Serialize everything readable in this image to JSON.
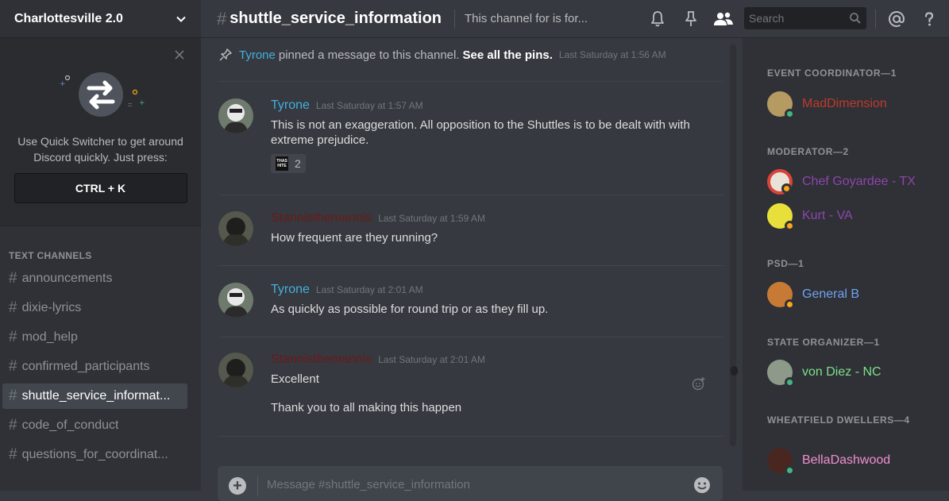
{
  "server": {
    "name": "Charlottesville 2.0"
  },
  "quick_switcher": {
    "text": "Use Quick Switcher to get around Discord quickly. Just press:",
    "shortcut": "CTRL + K"
  },
  "channels": {
    "category": "TEXT CHANNELS",
    "items": [
      {
        "label": "announcements"
      },
      {
        "label": "dixie-lyrics"
      },
      {
        "label": "mod_help"
      },
      {
        "label": "confirmed_participants"
      },
      {
        "label": "shuttle_service_informat..."
      },
      {
        "label": "code_of_conduct"
      },
      {
        "label": "questions_for_coordinat..."
      }
    ]
  },
  "header": {
    "channel": "shuttle_service_information",
    "topic": "This channel for is for...",
    "search_placeholder": "Search",
    "hash": "#"
  },
  "system_message": {
    "user": "Tyrone",
    "text": "pinned a message to this channel.",
    "link": "See all the pins.",
    "timestamp": "Last Saturday at 1:56 AM"
  },
  "messages": [
    {
      "author": "Tyrone",
      "color": "#43b0e0",
      "timestamp": "Last Saturday at 1:57 AM",
      "lines": [
        "This is not an exaggeration. All opposition to the Shuttles is to be dealt with with extreme prejudice."
      ],
      "reaction": {
        "emoji": "THAS HITE",
        "count": "2"
      }
    },
    {
      "author": "Stannisthemannis",
      "color": "#6b1a1a",
      "timestamp": "Last Saturday at 1:59 AM",
      "lines": [
        "How frequent are they running?"
      ]
    },
    {
      "author": "Tyrone",
      "color": "#43b0e0",
      "timestamp": "Last Saturday at 2:01 AM",
      "lines": [
        "As quickly as possible for round trip or as they fill up."
      ]
    },
    {
      "author": "Stannisthemannis",
      "color": "#6b1a1a",
      "timestamp": "Last Saturday at 2:01 AM",
      "lines": [
        "Excellent",
        "Thank you to all making this happen"
      ]
    }
  ],
  "composer": {
    "placeholder": "Message #shuttle_service_information",
    "plus": "+"
  },
  "members": {
    "groups": [
      {
        "role": "EVENT COORDINATOR—1",
        "members": [
          {
            "name": "MadDimension",
            "color": "#c0392b",
            "status": "online"
          }
        ]
      },
      {
        "role": "MODERATOR—2",
        "members": [
          {
            "name": "Chef Goyardee - TX",
            "color": "#8e44ad",
            "status": "idle"
          },
          {
            "name": "Kurt - VA",
            "color": "#8e44ad",
            "status": "idle"
          }
        ]
      },
      {
        "role": "PSD—1",
        "members": [
          {
            "name": "General B",
            "color": "#6fa3ef",
            "status": "idle"
          }
        ]
      },
      {
        "role": "STATE ORGANIZER—1",
        "members": [
          {
            "name": "von Diez - NC",
            "color": "#7ce08a",
            "status": "online"
          }
        ]
      },
      {
        "role": "WHEATFIELD DWELLERS—4",
        "members": [
          {
            "name": "BellaDashwood",
            "color": "#f08fd0",
            "status": "online"
          }
        ]
      }
    ]
  },
  "colors": {
    "online": "#43b581",
    "idle": "#faa61a",
    "accent": "#7289da"
  }
}
